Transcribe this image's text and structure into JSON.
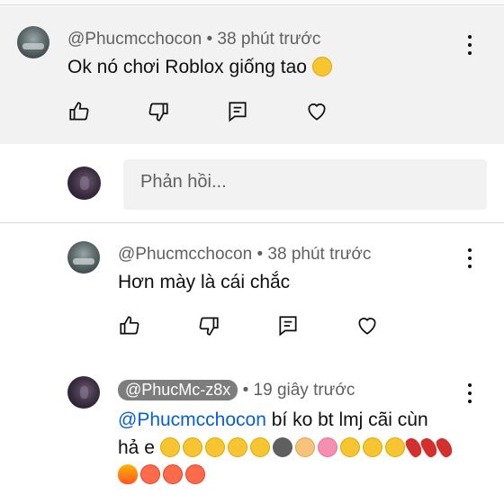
{
  "comment": {
    "author": "@Phucmcchocon",
    "time": "38 phút trước",
    "separator": "•",
    "text": "Ok nó chơi Roblox giống tao"
  },
  "reply_input": {
    "placeholder": "Phản hồi..."
  },
  "reply1": {
    "author": "@Phucmcchocon",
    "time": "38 phút trước",
    "separator": "•",
    "text": "Hơn mày là cái chắc"
  },
  "reply2": {
    "author": "@PhucMc-z8x",
    "time": "19 giây trước",
    "separator": "•",
    "mention": "@Phucmcchocon",
    "text_line1": " bí ko bt lmj cãi cùn",
    "text_line2": "hả e"
  },
  "icons": {
    "like": "thumbs-up-icon",
    "dislike": "thumbs-down-icon",
    "reply": "reply-comment-icon",
    "heart": "heart-icon",
    "more": "more-vert-icon"
  }
}
